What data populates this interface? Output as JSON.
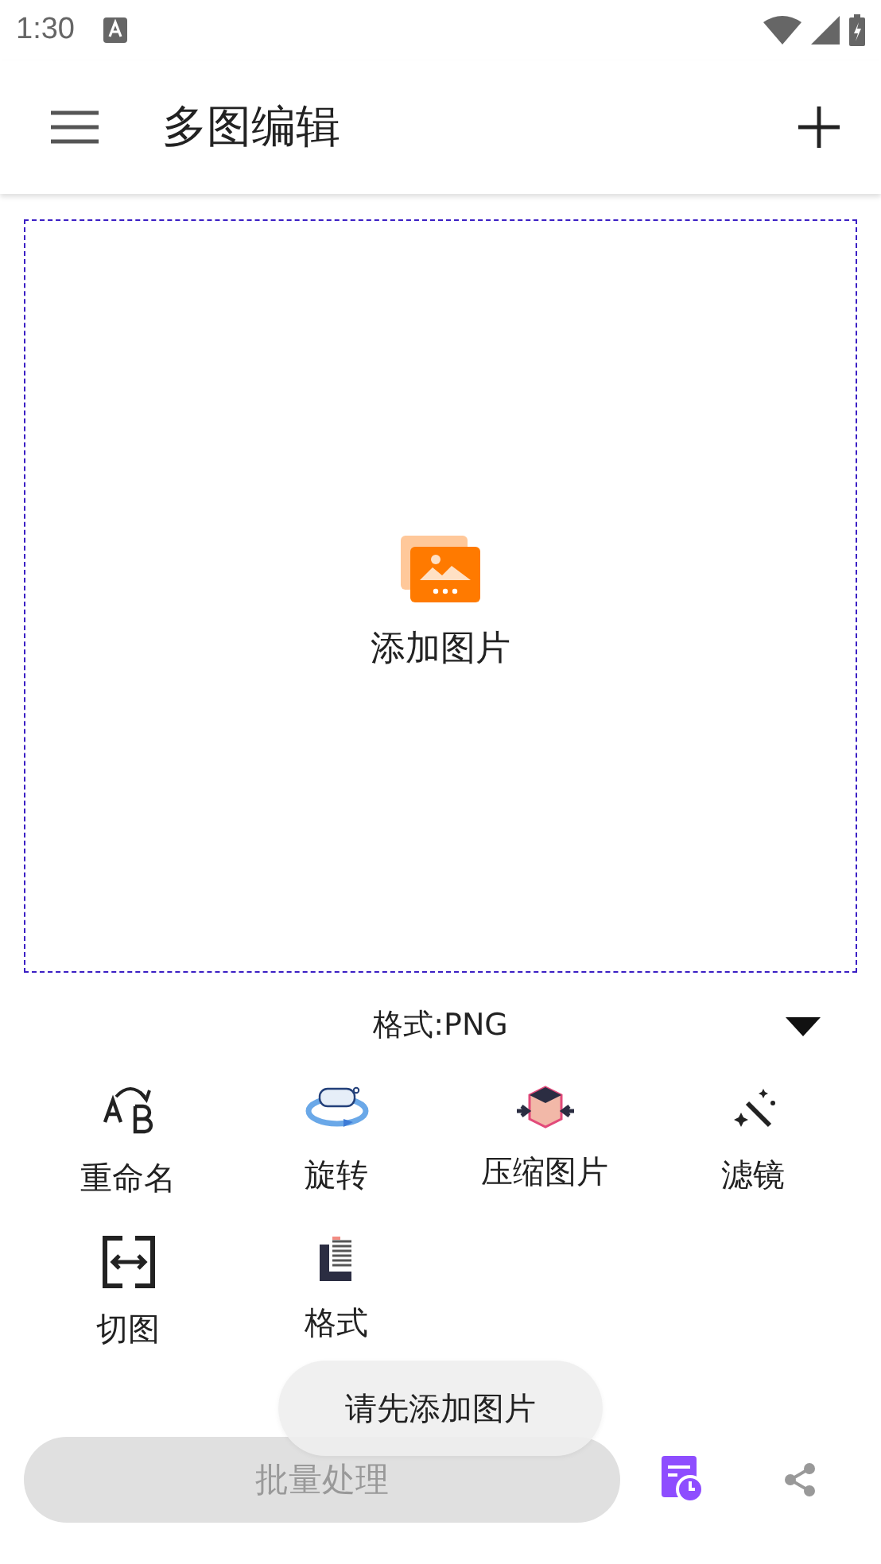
{
  "status_bar": {
    "time": "1:30"
  },
  "app_bar": {
    "title": "多图编辑"
  },
  "drop_zone": {
    "label": "添加图片"
  },
  "format_select": {
    "value": "格式:PNG"
  },
  "tools": [
    {
      "kind": "rename",
      "label": "重命名"
    },
    {
      "kind": "rotate",
      "label": "旋转"
    },
    {
      "kind": "compress",
      "label": "压缩图片"
    },
    {
      "kind": "filter",
      "label": "滤镜"
    },
    {
      "kind": "crop",
      "label": "切图"
    },
    {
      "kind": "format",
      "label": "格式"
    }
  ],
  "batch_button": {
    "label": "批量处理",
    "disabled": true
  },
  "toast": {
    "text": "请先添加图片"
  }
}
